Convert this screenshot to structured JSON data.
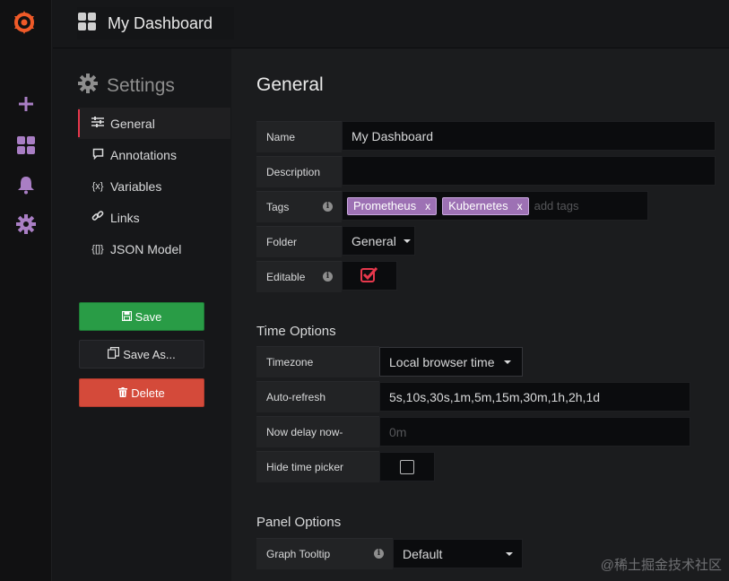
{
  "app": {
    "brand_color": "#f05a28",
    "accent_red": "#e7384c"
  },
  "navbar": {
    "title": "My Dashboard",
    "icon": "dashboard-grid-icon"
  },
  "sidemenu": {
    "items": [
      "plus-icon",
      "dashboards-icon",
      "bell-icon",
      "gear-icon"
    ]
  },
  "settings": {
    "heading": "Settings",
    "nav": [
      {
        "label": "General",
        "icon": "sliders-icon"
      },
      {
        "label": "Annotations",
        "icon": "comment-icon"
      },
      {
        "label": "Variables",
        "icon": "variable-icon"
      },
      {
        "label": "Links",
        "icon": "link-icon"
      },
      {
        "label": "JSON Model",
        "icon": "json-icon"
      }
    ],
    "buttons": {
      "save": "Save",
      "save_as": "Save As...",
      "delete": "Delete"
    }
  },
  "general": {
    "heading": "General",
    "name_label": "Name",
    "name_value": "My Dashboard",
    "description_label": "Description",
    "description_value": "",
    "tags_label": "Tags",
    "tags": [
      "Prometheus",
      "Kubernetes"
    ],
    "tag_remove": "x",
    "tags_placeholder": "add tags",
    "folder_label": "Folder",
    "folder_value": "General",
    "editable_label": "Editable",
    "editable_checked": true
  },
  "time_options": {
    "heading": "Time Options",
    "timezone_label": "Timezone",
    "timezone_value": "Local browser time",
    "autorefresh_label": "Auto-refresh",
    "autorefresh_value": "5s,10s,30s,1m,5m,15m,30m,1h,2h,1d",
    "nowdelay_label": "Now delay now-",
    "nowdelay_placeholder": "0m",
    "hide_picker_label": "Hide time picker",
    "hide_picker_checked": false
  },
  "panel_options": {
    "heading": "Panel Options",
    "tooltip_label": "Graph Tooltip",
    "tooltip_value": "Default"
  },
  "watermark": "@稀土掘金技术社区"
}
